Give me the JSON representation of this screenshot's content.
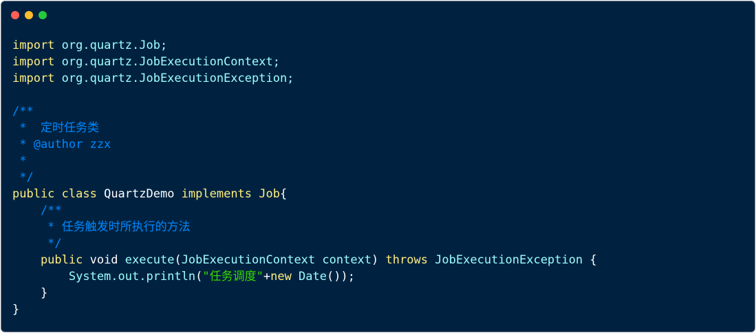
{
  "window": {
    "traffic_lights": {
      "close_color": "#ff5f56",
      "minimize_color": "#ffbd2e",
      "zoom_color": "#27c93f"
    }
  },
  "colors": {
    "background": "#002240",
    "keyword": "#ffee80",
    "identifier": "#9effff",
    "comment": "#0088ff",
    "string": "#3ad900",
    "plain": "#ffffff"
  },
  "code": {
    "lines": [
      [
        {
          "t": "import",
          "k": "kw"
        },
        {
          "t": " org.quartz.Job;",
          "k": "fn"
        }
      ],
      [
        {
          "t": "import",
          "k": "kw"
        },
        {
          "t": " org.quartz.JobExecutionContext;",
          "k": "fn"
        }
      ],
      [
        {
          "t": "import",
          "k": "kw"
        },
        {
          "t": " org.quartz.JobExecutionException;",
          "k": "fn"
        }
      ],
      [],
      [
        {
          "t": "/**",
          "k": "cm"
        }
      ],
      [
        {
          "t": " *  定时任务类",
          "k": "cm"
        }
      ],
      [
        {
          "t": " * @author zzx",
          "k": "cm"
        }
      ],
      [
        {
          "t": " *",
          "k": "cm"
        }
      ],
      [
        {
          "t": " */",
          "k": "cm"
        }
      ],
      [
        {
          "t": "public",
          "k": "kw"
        },
        {
          "t": " class ",
          "k": "kw"
        },
        {
          "t": "QuartzDemo",
          "k": "pl"
        },
        {
          "t": " implements ",
          "k": "kw"
        },
        {
          "t": "Job",
          "k": "kw"
        },
        {
          "t": "{",
          "k": "pl"
        }
      ],
      [
        {
          "t": "    /**",
          "k": "cm"
        }
      ],
      [
        {
          "t": "     * 任务触发时所执行的方法",
          "k": "cm"
        }
      ],
      [
        {
          "t": "     */",
          "k": "cm"
        }
      ],
      [
        {
          "t": "    public",
          "k": "kw"
        },
        {
          "t": " void ",
          "k": "pl"
        },
        {
          "t": "execute",
          "k": "fn"
        },
        {
          "t": "(",
          "k": "pl"
        },
        {
          "t": "JobExecutionContext context",
          "k": "fn"
        },
        {
          "t": ") ",
          "k": "pl"
        },
        {
          "t": "throws",
          "k": "kw"
        },
        {
          "t": " JobExecutionException ",
          "k": "fn"
        },
        {
          "t": "{",
          "k": "pl"
        }
      ],
      [
        {
          "t": "        System.out.println",
          "k": "fn"
        },
        {
          "t": "(",
          "k": "pl"
        },
        {
          "t": "\"任务调度\"",
          "k": "str"
        },
        {
          "t": "+",
          "k": "pl"
        },
        {
          "t": "new",
          "k": "kw"
        },
        {
          "t": " Date",
          "k": "fn"
        },
        {
          "t": "());",
          "k": "pl"
        }
      ],
      [
        {
          "t": "    }",
          "k": "pl"
        }
      ],
      [
        {
          "t": "}",
          "k": "pl"
        }
      ]
    ]
  }
}
